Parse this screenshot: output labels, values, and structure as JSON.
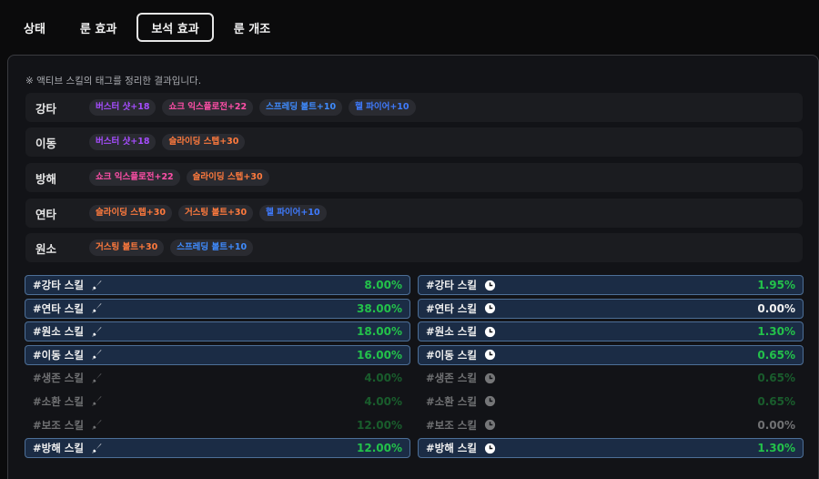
{
  "tabs": [
    {
      "label": "상태",
      "active": false
    },
    {
      "label": "룬 효과",
      "active": false
    },
    {
      "label": "보석 효과",
      "active": true
    },
    {
      "label": "룬 개조",
      "active": false
    }
  ],
  "note": "※ 액티브 스킬의 태그를 정리한 결과입니다.",
  "tag_rows": [
    {
      "label": "강타",
      "chips": [
        {
          "text": "버스터 샷+18",
          "color": "#a64dff"
        },
        {
          "text": "쇼크 익스플로전+22",
          "color": "#ff4fa8"
        },
        {
          "text": "스프레딩 볼트+10",
          "color": "#3f8cff"
        },
        {
          "text": "헬 파이어+10",
          "color": "#3f7bff"
        }
      ]
    },
    {
      "label": "이동",
      "chips": [
        {
          "text": "버스터 샷+18",
          "color": "#a64dff"
        },
        {
          "text": "슬라이딩 스텝+30",
          "color": "#ff7a3d"
        }
      ]
    },
    {
      "label": "방해",
      "chips": [
        {
          "text": "쇼크 익스플로전+22",
          "color": "#ff4fa8"
        },
        {
          "text": "슬라이딩 스텝+30",
          "color": "#ff7a3d"
        }
      ]
    },
    {
      "label": "연타",
      "chips": [
        {
          "text": "슬라이딩 스텝+30",
          "color": "#ff7a3d"
        },
        {
          "text": "거스팅 볼트+30",
          "color": "#ff7a3d"
        },
        {
          "text": "헬 파이어+10",
          "color": "#3f7bff"
        }
      ]
    },
    {
      "label": "원소",
      "chips": [
        {
          "text": "거스팅 볼트+30",
          "color": "#ff7a3d"
        },
        {
          "text": "스프레딩 볼트+10",
          "color": "#3f8cff"
        }
      ]
    }
  ],
  "damage_stats": [
    {
      "name": "#강타 스킬",
      "icon": "sword-icon",
      "value": "8.00%",
      "active": true,
      "value_color": "green"
    },
    {
      "name": "#연타 스킬",
      "icon": "sword-icon",
      "value": "38.00%",
      "active": true,
      "value_color": "green"
    },
    {
      "name": "#원소 스킬",
      "icon": "sword-icon",
      "value": "18.00%",
      "active": true,
      "value_color": "green"
    },
    {
      "name": "#이동 스킬",
      "icon": "sword-icon",
      "value": "16.00%",
      "active": true,
      "value_color": "green"
    },
    {
      "name": "#생존 스킬",
      "icon": "sword-icon",
      "value": "4.00%",
      "active": false,
      "value_color": "green"
    },
    {
      "name": "#소환 스킬",
      "icon": "sword-icon",
      "value": "4.00%",
      "active": false,
      "value_color": "green"
    },
    {
      "name": "#보조 스킬",
      "icon": "sword-icon",
      "value": "12.00%",
      "active": false,
      "value_color": "green"
    },
    {
      "name": "#방해 스킬",
      "icon": "sword-icon",
      "value": "12.00%",
      "active": true,
      "value_color": "green"
    }
  ],
  "cooldown_stats": [
    {
      "name": "#강타 스킬",
      "icon": "clock-icon",
      "value": "1.95%",
      "active": true,
      "value_color": "green"
    },
    {
      "name": "#연타 스킬",
      "icon": "clock-icon",
      "value": "0.00%",
      "active": true,
      "value_color": "white"
    },
    {
      "name": "#원소 스킬",
      "icon": "clock-icon",
      "value": "1.30%",
      "active": true,
      "value_color": "green"
    },
    {
      "name": "#이동 스킬",
      "icon": "clock-icon",
      "value": "0.65%",
      "active": true,
      "value_color": "green"
    },
    {
      "name": "#생존 스킬",
      "icon": "clock-icon",
      "value": "0.65%",
      "active": false,
      "value_color": "green"
    },
    {
      "name": "#소환 스킬",
      "icon": "clock-icon",
      "value": "0.65%",
      "active": false,
      "value_color": "green"
    },
    {
      "name": "#보조 스킬",
      "icon": "clock-icon",
      "value": "0.00%",
      "active": false,
      "value_color": "white"
    },
    {
      "name": "#방해 스킬",
      "icon": "clock-icon",
      "value": "1.30%",
      "active": true,
      "value_color": "green"
    }
  ]
}
